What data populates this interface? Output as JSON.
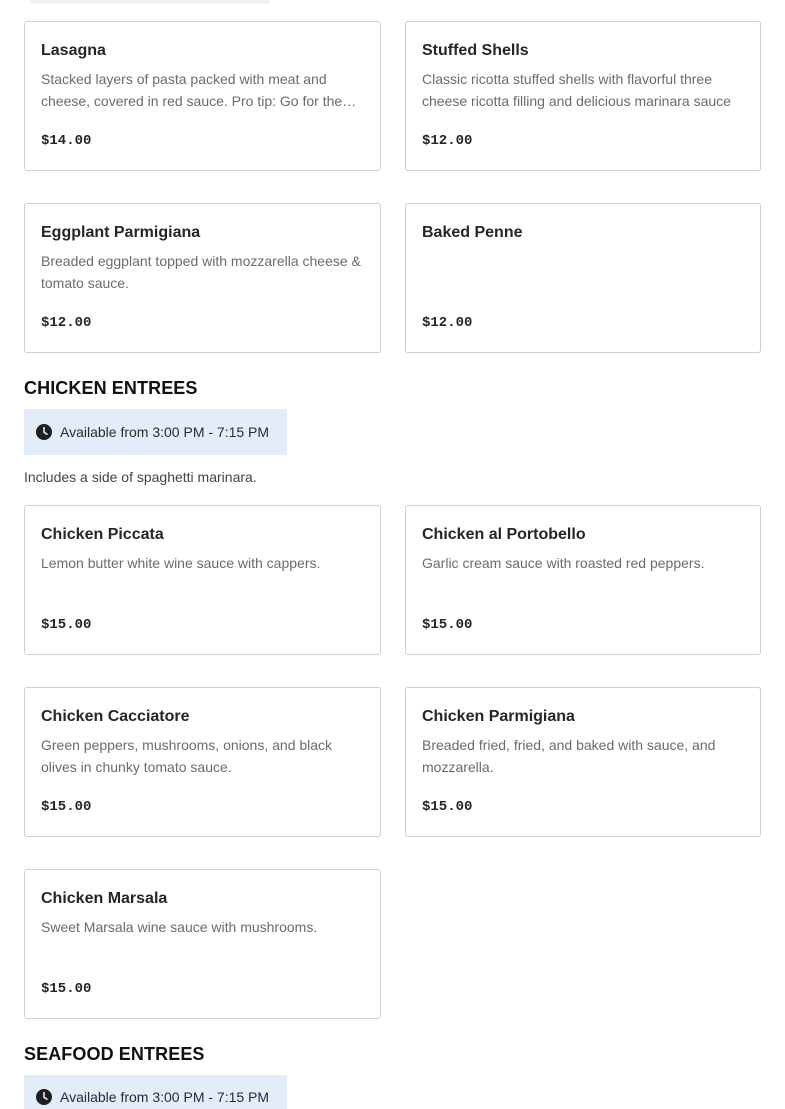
{
  "pasta_items": [
    {
      "name": "Lasagna",
      "description": "Stacked layers of pasta packed with meat and cheese, covered in red sauce. Pro tip: Go for the…",
      "price": "$14.00"
    },
    {
      "name": "Stuffed Shells",
      "description": "Classic ricotta stuffed shells with flavorful three cheese ricotta filling and delicious marinara sauce",
      "price": "$12.00"
    },
    {
      "name": "Eggplant Parmigiana",
      "description": "Breaded eggplant topped with mozzarella cheese & tomato sauce.",
      "price": "$12.00"
    },
    {
      "name": "Baked Penne",
      "description": "",
      "price": "$12.00"
    }
  ],
  "chicken_section": {
    "title": "CHICKEN ENTREES",
    "hours": "Available from 3:00 PM - 7:15 PM",
    "note": "Includes a side of spaghetti marinara.",
    "items": [
      {
        "name": "Chicken Piccata",
        "description": "Lemon butter white wine sauce with cappers.",
        "price": "$15.00"
      },
      {
        "name": "Chicken al Portobello",
        "description": "Garlic cream sauce with roasted red peppers.",
        "price": "$15.00"
      },
      {
        "name": "Chicken Cacciatore",
        "description": "Green peppers, mushrooms, onions, and black olives in chunky tomato sauce.",
        "price": "$15.00"
      },
      {
        "name": "Chicken Parmigiana",
        "description": "Breaded fried, fried, and baked with sauce, and mozzarella.",
        "price": "$15.00"
      },
      {
        "name": "Chicken Marsala",
        "description": "Sweet Marsala wine sauce with mushrooms.",
        "price": "$15.00"
      }
    ]
  },
  "seafood_section": {
    "title": "SEAFOOD ENTREES",
    "hours": "Available from 3:00 PM - 7:15 PM"
  },
  "icons": {
    "clock": "clock-icon"
  },
  "colors": {
    "badge_bg": "#e3edf9",
    "card_border": "#cfcfcf",
    "description_text": "#6b6b6b"
  }
}
